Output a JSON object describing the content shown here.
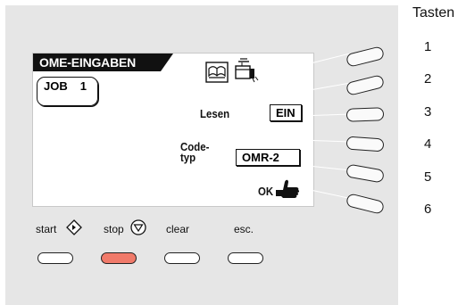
{
  "screen": {
    "title": "OME-EINGABEN",
    "job_label": "JOB",
    "job_number": "1",
    "read_label": "Lesen",
    "read_value": "EIN",
    "codetype_label_line1": "Code-",
    "codetype_label_line2": "typ",
    "codetype_value": "OMR-2",
    "ok_label": "OK"
  },
  "tasten": {
    "title": "Tasten",
    "numbers": [
      "1",
      "2",
      "3",
      "4",
      "5",
      "6"
    ]
  },
  "function_keys": {
    "start": "start",
    "stop": "stop",
    "clear": "clear",
    "esc": "esc."
  },
  "colors": {
    "panel": "#e6e6e6",
    "stop_button": "#f07a6a",
    "screen_title_bg": "#111111"
  },
  "icons": [
    "book-icon",
    "feeder-icon",
    "start-diamond-icon",
    "stop-triangle-icon",
    "thumbs-up-hand-icon"
  ]
}
